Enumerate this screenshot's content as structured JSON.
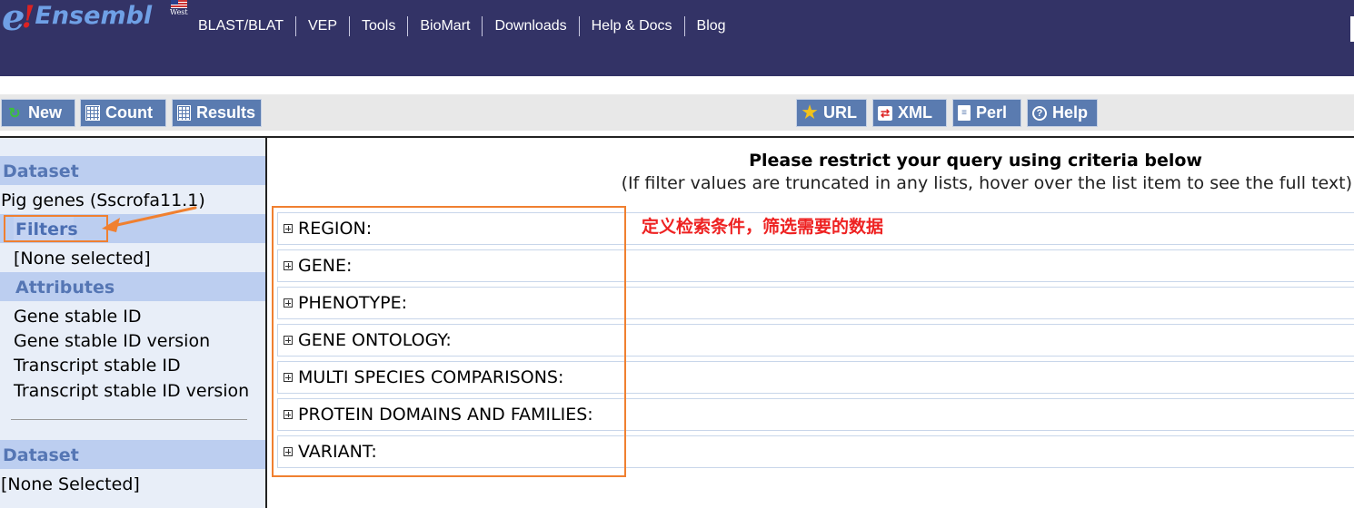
{
  "header": {
    "logo_e": "e",
    "logo_bang": "!",
    "logo_name": "Ensembl",
    "logo_badge": "West",
    "nav": [
      "BLAST/BLAT",
      "VEP",
      "Tools",
      "BioMart",
      "Downloads",
      "Help & Docs",
      "Blog"
    ]
  },
  "toolbar": {
    "new_label": "New",
    "count_label": "Count",
    "results_label": "Results",
    "url_label": "URL",
    "xml_label": "XML",
    "perl_label": "Perl",
    "help_label": "Help"
  },
  "sidebar": {
    "dataset_heading": "Dataset",
    "dataset_value": "Pig genes (Sscrofa11.1)",
    "filters_heading": "Filters",
    "filters_value": "[None selected]",
    "attributes_heading": "Attributes",
    "attributes": [
      "Gene stable ID",
      "Gene stable ID version",
      "Transcript stable ID",
      "Transcript stable ID version"
    ],
    "dataset2_heading": "Dataset",
    "dataset2_value": "[None Selected]"
  },
  "main": {
    "title": "Please restrict your query using criteria below",
    "subtitle": "(If filter values are truncated in any lists, hover over the list item to see the full text)",
    "filter_sections": [
      "REGION:",
      "GENE:",
      "PHENOTYPE:",
      "GENE ONTOLOGY:",
      "MULTI SPECIES COMPARISONS:",
      "PROTEIN DOMAINS AND FAMILIES:",
      "VARIANT:"
    ],
    "annotation": "定义检索条件，筛选需要的数据"
  },
  "colors": {
    "header_bg": "#333366",
    "button_bg": "#5a7bb0",
    "section_heading_bg": "#bccef0",
    "highlight_orange": "#f08030",
    "annotation_red": "#ee2222"
  }
}
